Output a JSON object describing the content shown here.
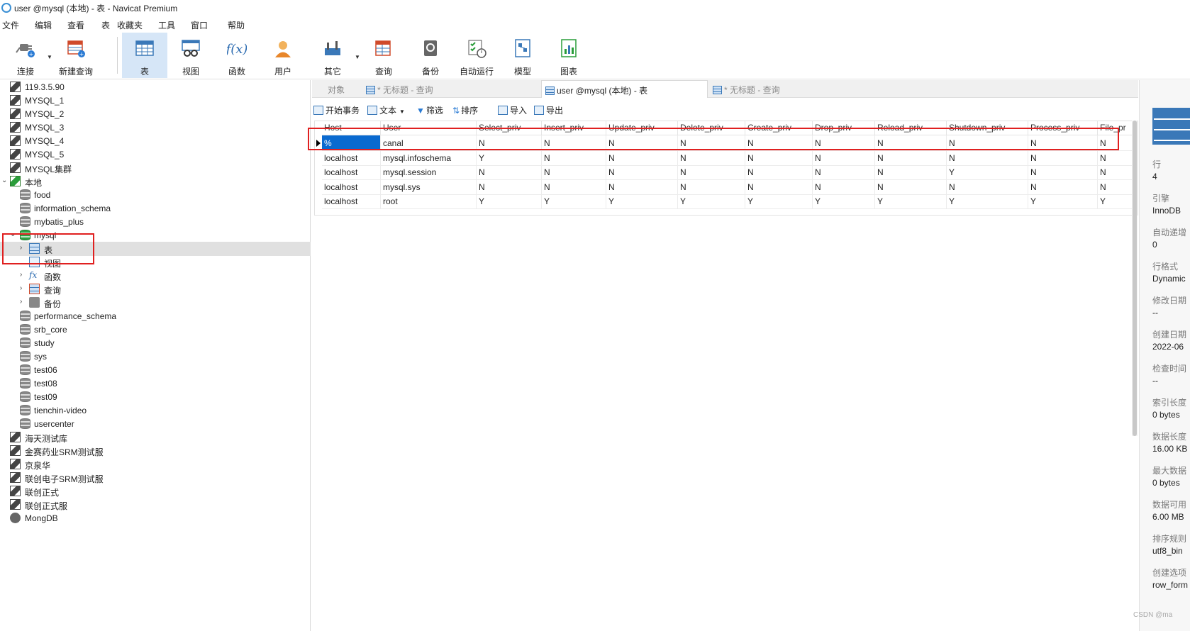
{
  "window": {
    "title": "user @mysql (本地) - 表 - Navicat Premium"
  },
  "menu": [
    "文件",
    "编辑",
    "查看",
    "表",
    "收藏夹",
    "工具",
    "窗口",
    "帮助"
  ],
  "toolbar": {
    "connect": "连接",
    "new_query": "新建查询",
    "table": "表",
    "view": "视图",
    "function": "函数",
    "user": "用户",
    "other": "其它",
    "query": "查询",
    "backup": "备份",
    "auto_run": "自动运行",
    "model": "模型",
    "chart": "图表"
  },
  "sidebar": {
    "connections_top": [
      "119.3.5.90",
      "MYSQL_1",
      "MYSQL_2",
      "MYSQL_3",
      "MYSQL_4",
      "MYSQL_5",
      "MYSQL集群"
    ],
    "local": "本地",
    "local_dbs_top": [
      "food",
      "information_schema",
      "mybatis_plus"
    ],
    "mysql": "mysql",
    "mysql_children": [
      "表",
      "视图",
      "函数",
      "查询",
      "备份"
    ],
    "local_dbs_bottom": [
      "performance_schema",
      "srb_core",
      "study",
      "sys",
      "test06",
      "test08",
      "test09",
      "tienchin-video",
      "usercenter"
    ],
    "connections_bottom": [
      "海天测试库",
      "金赛药业SRM测试服",
      "京泉华",
      "联创电子SRM测试服",
      "联创正式",
      "联创正式服",
      "MongDB"
    ]
  },
  "tabs": {
    "objects": "对象",
    "untitled1": "* 无标题 - 查询",
    "active": "user @mysql (本地) - 表",
    "untitled2": "* 无标题 - 查询"
  },
  "subtoolbar": {
    "begin_tx": "开始事务",
    "text": "文本",
    "filter": "筛选",
    "sort": "排序",
    "import": "导入",
    "export": "导出"
  },
  "grid": {
    "columns": [
      "Host",
      "User",
      "Select_priv",
      "Insert_priv",
      "Update_priv",
      "Delete_priv",
      "Create_priv",
      "Drop_priv",
      "Reload_priv",
      "Shutdown_priv",
      "Process_priv",
      "File_pr"
    ],
    "rows": [
      [
        "%",
        "canal",
        "N",
        "N",
        "N",
        "N",
        "N",
        "N",
        "N",
        "N",
        "N",
        "N"
      ],
      [
        "localhost",
        "mysql.infoschema",
        "Y",
        "N",
        "N",
        "N",
        "N",
        "N",
        "N",
        "N",
        "N",
        "N"
      ],
      [
        "localhost",
        "mysql.session",
        "N",
        "N",
        "N",
        "N",
        "N",
        "N",
        "N",
        "Y",
        "N",
        "N"
      ],
      [
        "localhost",
        "mysql.sys",
        "N",
        "N",
        "N",
        "N",
        "N",
        "N",
        "N",
        "N",
        "N",
        "N"
      ],
      [
        "localhost",
        "root",
        "Y",
        "Y",
        "Y",
        "Y",
        "Y",
        "Y",
        "Y",
        "Y",
        "Y",
        "Y"
      ]
    ]
  },
  "info": {
    "rows_label": "行",
    "rows_value": "4",
    "engine_label": "引擎",
    "engine_value": "InnoDB",
    "auto_inc_label": "自动递增",
    "auto_inc_value": "0",
    "row_format_label": "行格式",
    "row_format_value": "Dynamic",
    "modified_label": "修改日期",
    "modified_value": "--",
    "created_label": "创建日期",
    "created_value": "2022-06",
    "checked_label": "检查时间",
    "checked_value": "--",
    "index_len_label": "索引长度",
    "index_len_value": "0 bytes",
    "data_len_label": "数据长度",
    "data_len_value": "16.00 KB",
    "max_data_label": "最大数据",
    "max_data_value": "0 bytes",
    "data_free_label": "数据可用",
    "data_free_value": "6.00 MB",
    "collation_label": "排序规则",
    "collation_value": "utf8_bin",
    "create_opts_label": "创建选项",
    "create_opts_value": "row_form"
  },
  "watermark": "CSDN @ma",
  "colors": {
    "selection": "#0a6ad0",
    "highlight_box": "#e02020",
    "active_tool": "#d6e6f7"
  }
}
